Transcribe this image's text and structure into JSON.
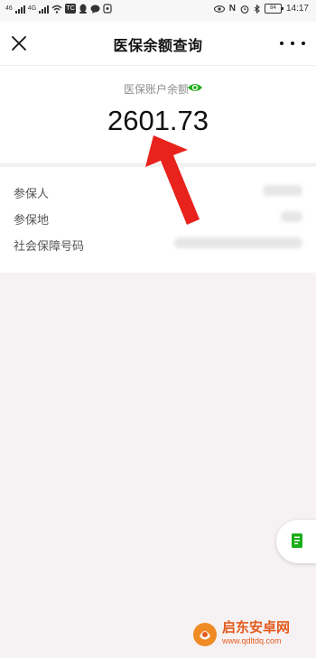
{
  "status_bar": {
    "sim1": "46",
    "sim2": "4G",
    "nfc_label": "N",
    "battery": "84",
    "time": "14:17",
    "app_badge": "TC"
  },
  "nav": {
    "title": "医保余额查询"
  },
  "balance": {
    "label": "医保账户余额",
    "amount": "2601.73",
    "eye_color": "#1aad19"
  },
  "info": {
    "rows": [
      {
        "label": "参保人"
      },
      {
        "label": "参保地"
      },
      {
        "label": "社会保障号码"
      }
    ]
  },
  "annotation": {
    "arrow_color": "#e8221c"
  },
  "watermark": {
    "title": "启东安卓网",
    "url": "www.qdltdq.com"
  }
}
